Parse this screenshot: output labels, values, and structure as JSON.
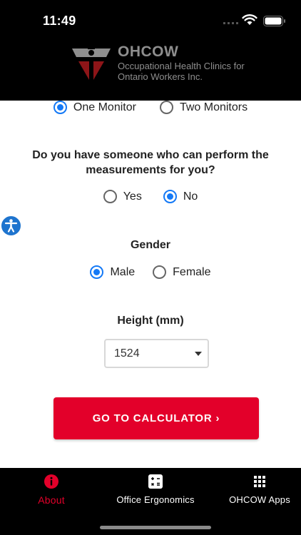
{
  "status_bar": {
    "time": "11:49"
  },
  "header": {
    "logo_title": "OHCOW",
    "logo_subtitle": "Occupational Health Clinics for Ontario Workers Inc."
  },
  "monitors": {
    "options": [
      {
        "label": "One Monitor",
        "selected": true
      },
      {
        "label": "Two Monitors",
        "selected": false
      }
    ]
  },
  "measurements": {
    "question": "Do you have someone who can perform the measurements for you?",
    "options": [
      {
        "label": "Yes",
        "selected": false
      },
      {
        "label": "No",
        "selected": true
      }
    ]
  },
  "gender": {
    "label": "Gender",
    "options": [
      {
        "label": "Male",
        "selected": true
      },
      {
        "label": "Female",
        "selected": false
      }
    ]
  },
  "height": {
    "label": "Height (mm)",
    "value": "1524"
  },
  "calculator_button": {
    "label": "GO TO CALCULATOR ›"
  },
  "tabs": [
    {
      "label": "About",
      "icon": "info-icon",
      "active": true
    },
    {
      "label": "Office Ergonomics",
      "icon": "calculator-icon",
      "active": false
    },
    {
      "label": "OHCOW Apps",
      "icon": "grid-icon",
      "active": false
    }
  ],
  "colors": {
    "accent_red": "#e3002a",
    "radio_blue": "#1479f6",
    "accessibility_blue": "#1e74ce"
  }
}
